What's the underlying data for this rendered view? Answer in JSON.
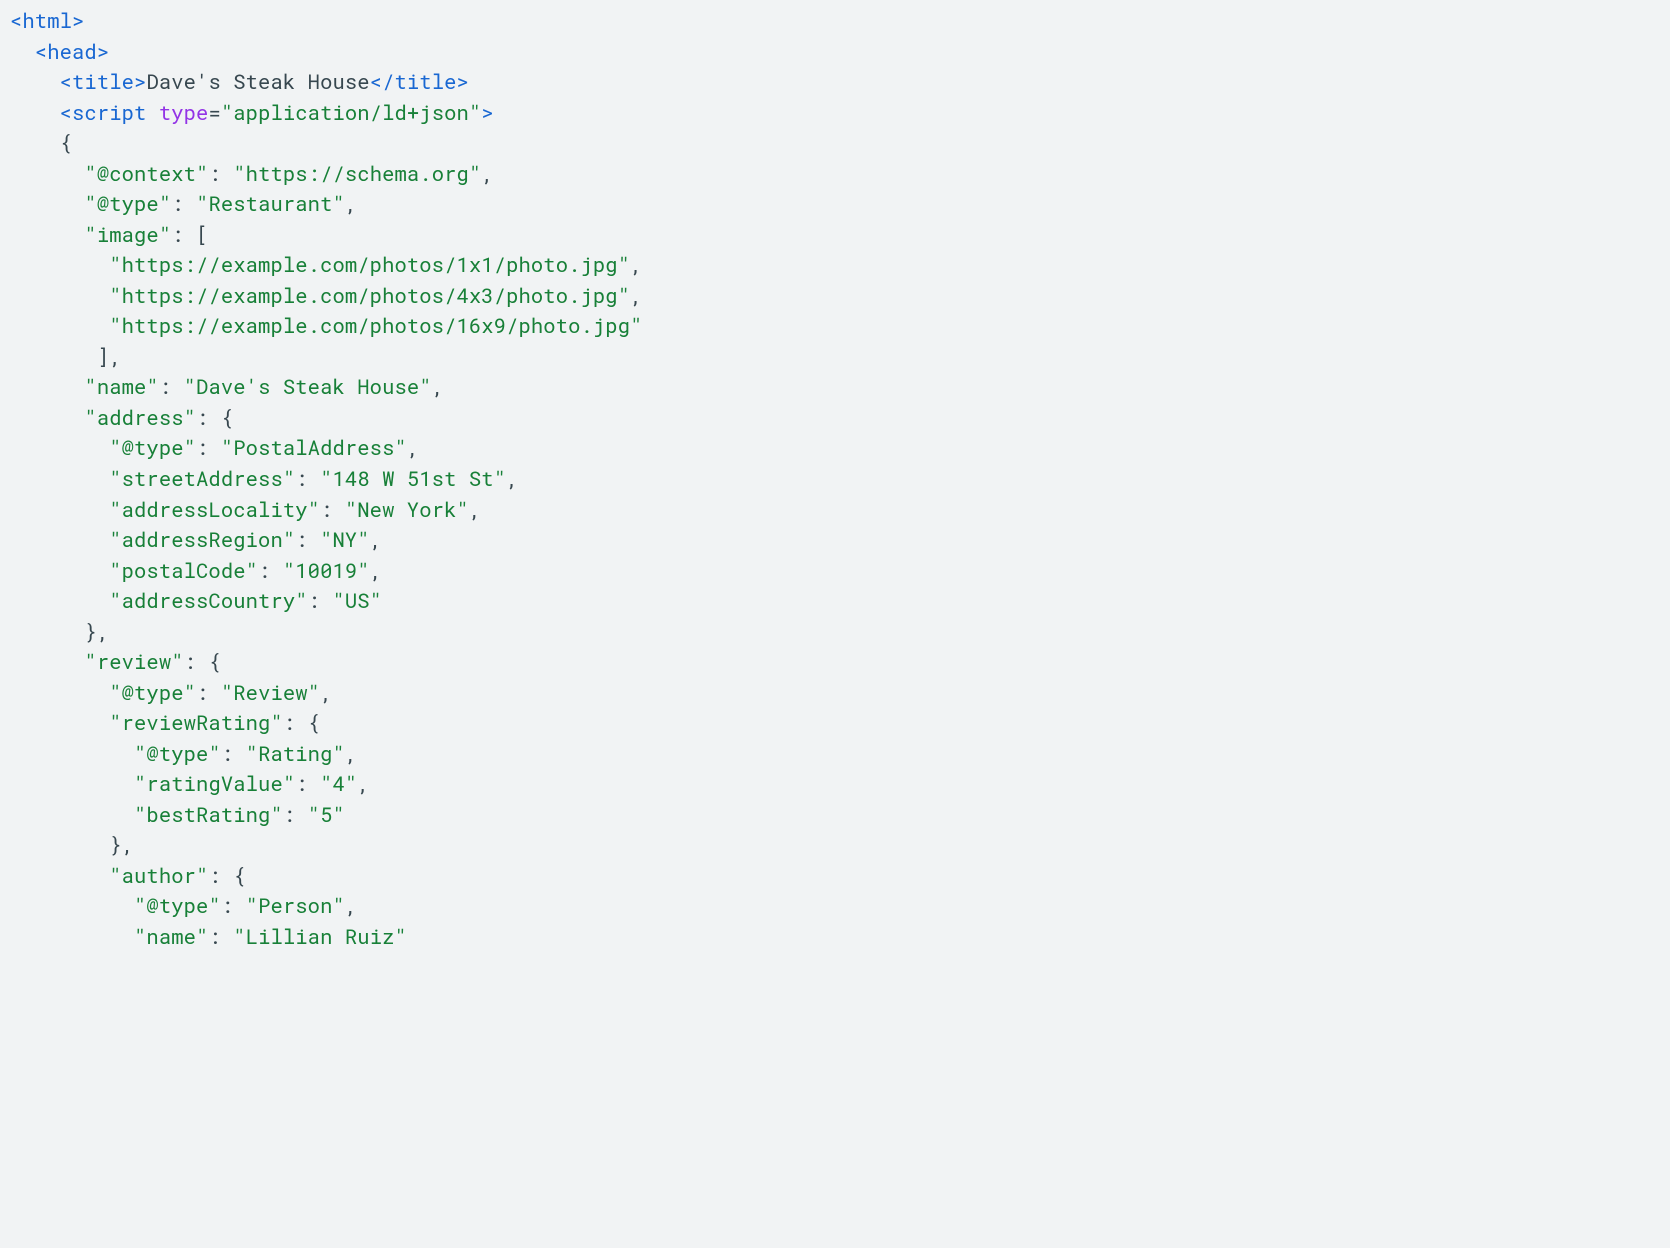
{
  "code": {
    "tokens": [
      [
        [
          "tag",
          "<html>"
        ]
      ],
      [
        [
          "txt",
          "  "
        ],
        [
          "tag",
          "<head>"
        ]
      ],
      [
        [
          "txt",
          "    "
        ],
        [
          "tag",
          "<title>"
        ],
        [
          "txt",
          "Dave's Steak House"
        ],
        [
          "tag",
          "</title>"
        ]
      ],
      [
        [
          "txt",
          "    "
        ],
        [
          "tag",
          "<script"
        ],
        [
          "txt",
          " "
        ],
        [
          "attr",
          "type"
        ],
        [
          "txt",
          "="
        ],
        [
          "str",
          "\"application/ld+json\""
        ],
        [
          "tag",
          ">"
        ]
      ],
      [
        [
          "txt",
          "    {"
        ]
      ],
      [
        [
          "txt",
          "      "
        ],
        [
          "str",
          "\"@context\""
        ],
        [
          "txt",
          ": "
        ],
        [
          "str",
          "\"https://schema.org\""
        ],
        [
          "txt",
          ","
        ]
      ],
      [
        [
          "txt",
          "      "
        ],
        [
          "str",
          "\"@type\""
        ],
        [
          "txt",
          ": "
        ],
        [
          "str",
          "\"Restaurant\""
        ],
        [
          "txt",
          ","
        ]
      ],
      [
        [
          "txt",
          "      "
        ],
        [
          "str",
          "\"image\""
        ],
        [
          "txt",
          ": ["
        ]
      ],
      [
        [
          "txt",
          "        "
        ],
        [
          "str",
          "\"https://example.com/photos/1x1/photo.jpg\""
        ],
        [
          "txt",
          ","
        ]
      ],
      [
        [
          "txt",
          "        "
        ],
        [
          "str",
          "\"https://example.com/photos/4x3/photo.jpg\""
        ],
        [
          "txt",
          ","
        ]
      ],
      [
        [
          "txt",
          "        "
        ],
        [
          "str",
          "\"https://example.com/photos/16x9/photo.jpg\""
        ]
      ],
      [
        [
          "txt",
          "       ],"
        ]
      ],
      [
        [
          "txt",
          "      "
        ],
        [
          "str",
          "\"name\""
        ],
        [
          "txt",
          ": "
        ],
        [
          "str",
          "\"Dave's Steak House\""
        ],
        [
          "txt",
          ","
        ]
      ],
      [
        [
          "txt",
          "      "
        ],
        [
          "str",
          "\"address\""
        ],
        [
          "txt",
          ": {"
        ]
      ],
      [
        [
          "txt",
          "        "
        ],
        [
          "str",
          "\"@type\""
        ],
        [
          "txt",
          ": "
        ],
        [
          "str",
          "\"PostalAddress\""
        ],
        [
          "txt",
          ","
        ]
      ],
      [
        [
          "txt",
          "        "
        ],
        [
          "str",
          "\"streetAddress\""
        ],
        [
          "txt",
          ": "
        ],
        [
          "str",
          "\"148 W 51st St\""
        ],
        [
          "txt",
          ","
        ]
      ],
      [
        [
          "txt",
          "        "
        ],
        [
          "str",
          "\"addressLocality\""
        ],
        [
          "txt",
          ": "
        ],
        [
          "str",
          "\"New York\""
        ],
        [
          "txt",
          ","
        ]
      ],
      [
        [
          "txt",
          "        "
        ],
        [
          "str",
          "\"addressRegion\""
        ],
        [
          "txt",
          ": "
        ],
        [
          "str",
          "\"NY\""
        ],
        [
          "txt",
          ","
        ]
      ],
      [
        [
          "txt",
          "        "
        ],
        [
          "str",
          "\"postalCode\""
        ],
        [
          "txt",
          ": "
        ],
        [
          "str",
          "\"10019\""
        ],
        [
          "txt",
          ","
        ]
      ],
      [
        [
          "txt",
          "        "
        ],
        [
          "str",
          "\"addressCountry\""
        ],
        [
          "txt",
          ": "
        ],
        [
          "str",
          "\"US\""
        ]
      ],
      [
        [
          "txt",
          "      },"
        ]
      ],
      [
        [
          "txt",
          "      "
        ],
        [
          "str",
          "\"review\""
        ],
        [
          "txt",
          ": {"
        ]
      ],
      [
        [
          "txt",
          "        "
        ],
        [
          "str",
          "\"@type\""
        ],
        [
          "txt",
          ": "
        ],
        [
          "str",
          "\"Review\""
        ],
        [
          "txt",
          ","
        ]
      ],
      [
        [
          "txt",
          "        "
        ],
        [
          "str",
          "\"reviewRating\""
        ],
        [
          "txt",
          ": {"
        ]
      ],
      [
        [
          "txt",
          "          "
        ],
        [
          "str",
          "\"@type\""
        ],
        [
          "txt",
          ": "
        ],
        [
          "str",
          "\"Rating\""
        ],
        [
          "txt",
          ","
        ]
      ],
      [
        [
          "txt",
          "          "
        ],
        [
          "str",
          "\"ratingValue\""
        ],
        [
          "txt",
          ": "
        ],
        [
          "str",
          "\"4\""
        ],
        [
          "txt",
          ","
        ]
      ],
      [
        [
          "txt",
          "          "
        ],
        [
          "str",
          "\"bestRating\""
        ],
        [
          "txt",
          ": "
        ],
        [
          "str",
          "\"5\""
        ]
      ],
      [
        [
          "txt",
          "        },"
        ]
      ],
      [
        [
          "txt",
          "        "
        ],
        [
          "str",
          "\"author\""
        ],
        [
          "txt",
          ": {"
        ]
      ],
      [
        [
          "txt",
          "          "
        ],
        [
          "str",
          "\"@type\""
        ],
        [
          "txt",
          ": "
        ],
        [
          "str",
          "\"Person\""
        ],
        [
          "txt",
          ","
        ]
      ],
      [
        [
          "txt",
          "          "
        ],
        [
          "str",
          "\"name\""
        ],
        [
          "txt",
          ": "
        ],
        [
          "str",
          "\"Lillian Ruiz\""
        ]
      ]
    ]
  }
}
